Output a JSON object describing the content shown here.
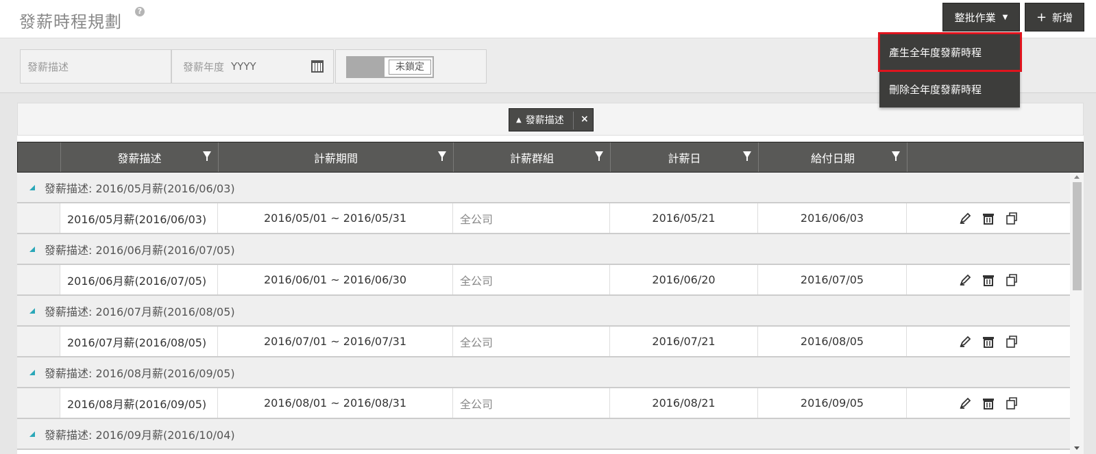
{
  "header": {
    "title": "發薪時程規劃",
    "help_glyph": "?",
    "batch_label": "整批作業",
    "add_label": "新增"
  },
  "dropdown": {
    "items": [
      {
        "label": "產生全年度發薪時程"
      },
      {
        "label": "刪除全年度發薪時程"
      }
    ]
  },
  "filters": {
    "desc_placeholder": "發薪描述",
    "year_label": "發薪年度",
    "year_placeholder": "YYYY",
    "lock_label": "未鎖定"
  },
  "grouping": {
    "chip_label": "發薪描述"
  },
  "table": {
    "columns": [
      "發薪描述",
      "計薪期間",
      "計薪群組",
      "計薪日",
      "給付日期"
    ],
    "groups": [
      {
        "label": "發薪描述: 2016/05月薪(2016/06/03)",
        "row": {
          "desc": "2016/05月薪(2016/06/03)",
          "period": "2016/05/01 ~ 2016/05/31",
          "group": "全公司",
          "calc_day": "2016/05/21",
          "pay_date": "2016/06/03"
        }
      },
      {
        "label": "發薪描述: 2016/06月薪(2016/07/05)",
        "row": {
          "desc": "2016/06月薪(2016/07/05)",
          "period": "2016/06/01 ~ 2016/06/30",
          "group": "全公司",
          "calc_day": "2016/06/20",
          "pay_date": "2016/07/05"
        }
      },
      {
        "label": "發薪描述: 2016/07月薪(2016/08/05)",
        "row": {
          "desc": "2016/07月薪(2016/08/05)",
          "period": "2016/07/01 ~ 2016/07/31",
          "group": "全公司",
          "calc_day": "2016/07/21",
          "pay_date": "2016/08/05"
        }
      },
      {
        "label": "發薪描述: 2016/08月薪(2016/09/05)",
        "row": {
          "desc": "2016/08月薪(2016/09/05)",
          "period": "2016/08/01 ~ 2016/08/31",
          "group": "全公司",
          "calc_day": "2016/08/21",
          "pay_date": "2016/09/05"
        }
      },
      {
        "label": "發薪描述: 2016/09月薪(2016/10/04)"
      }
    ]
  },
  "colors": {
    "accent_highlight": "#e0141e",
    "header_dark": "#3d3d3b",
    "group_triangle": "#2aa7b8"
  },
  "icons": [
    "help-icon",
    "caret-down-icon",
    "plus-icon",
    "calendar-icon",
    "sort-up-icon",
    "close-icon",
    "filter-icon",
    "expand-triangle-icon",
    "edit-icon",
    "delete-icon",
    "copy-icon"
  ]
}
